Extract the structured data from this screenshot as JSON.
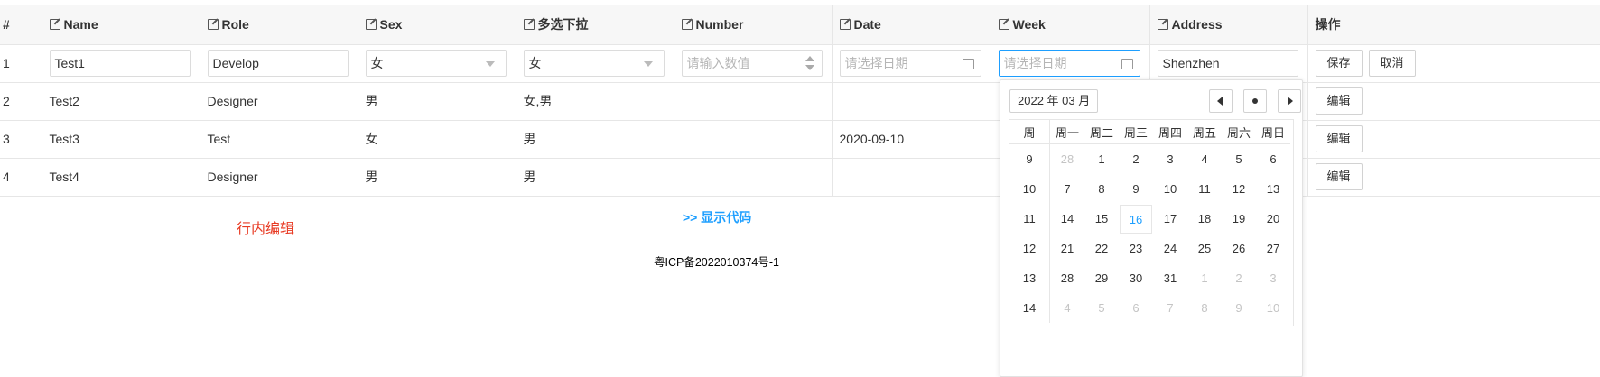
{
  "columns": [
    "#",
    "Name",
    "Role",
    "Sex",
    "多选下拉",
    "Number",
    "Date",
    "Week",
    "Address",
    "操作"
  ],
  "edit_row": {
    "id": "1",
    "name": "Test1",
    "role": "Develop",
    "sex": "女",
    "multi": "女",
    "number_placeholder": "请输入数值",
    "date_placeholder": "请选择日期",
    "week_placeholder": "请选择日期",
    "address": "Shenzhen",
    "save_label": "保存",
    "cancel_label": "取消"
  },
  "rows": [
    {
      "id": "2",
      "name": "Test2",
      "role": "Designer",
      "sex": "男",
      "multi": "女,男",
      "number": "",
      "date": "",
      "edit_label": "编辑"
    },
    {
      "id": "3",
      "name": "Test3",
      "role": "Test",
      "sex": "女",
      "multi": "男",
      "number": "",
      "date": "2020-09-10",
      "edit_label": "编辑"
    },
    {
      "id": "4",
      "name": "Test4",
      "role": "Designer",
      "sex": "男",
      "multi": "男",
      "number": "",
      "date": "",
      "edit_label": "编辑"
    }
  ],
  "inline_edit_title": "行内编辑",
  "show_code_link": ">> 显示代码",
  "icp": "粤ICP备2022010374号-1",
  "picker": {
    "month_label": "2022 年 03 月",
    "weekday_headers": [
      "周",
      "周一",
      "周二",
      "周三",
      "周四",
      "周五",
      "周六",
      "周日"
    ],
    "today": "16",
    "weeks": [
      {
        "wk": "9",
        "days": [
          {
            "d": "28",
            "dim": true
          },
          {
            "d": "1"
          },
          {
            "d": "2"
          },
          {
            "d": "3"
          },
          {
            "d": "4"
          },
          {
            "d": "5"
          },
          {
            "d": "6"
          }
        ]
      },
      {
        "wk": "10",
        "days": [
          {
            "d": "7"
          },
          {
            "d": "8"
          },
          {
            "d": "9"
          },
          {
            "d": "10"
          },
          {
            "d": "11"
          },
          {
            "d": "12"
          },
          {
            "d": "13"
          }
        ]
      },
      {
        "wk": "11",
        "days": [
          {
            "d": "14"
          },
          {
            "d": "15"
          },
          {
            "d": "16",
            "today": true
          },
          {
            "d": "17"
          },
          {
            "d": "18"
          },
          {
            "d": "19"
          },
          {
            "d": "20"
          }
        ]
      },
      {
        "wk": "12",
        "days": [
          {
            "d": "21"
          },
          {
            "d": "22"
          },
          {
            "d": "23"
          },
          {
            "d": "24"
          },
          {
            "d": "25"
          },
          {
            "d": "26"
          },
          {
            "d": "27"
          }
        ]
      },
      {
        "wk": "13",
        "days": [
          {
            "d": "28"
          },
          {
            "d": "29"
          },
          {
            "d": "30"
          },
          {
            "d": "31"
          },
          {
            "d": "1",
            "dim": true
          },
          {
            "d": "2",
            "dim": true
          },
          {
            "d": "3",
            "dim": true
          }
        ]
      },
      {
        "wk": "14",
        "days": [
          {
            "d": "4",
            "dim": true
          },
          {
            "d": "5",
            "dim": true
          },
          {
            "d": "6",
            "dim": true
          },
          {
            "d": "7",
            "dim": true
          },
          {
            "d": "8",
            "dim": true
          },
          {
            "d": "9",
            "dim": true
          },
          {
            "d": "10",
            "dim": true
          }
        ]
      }
    ]
  },
  "colors": {
    "accent": "#1e9fff",
    "title_red": "#e83b24"
  }
}
